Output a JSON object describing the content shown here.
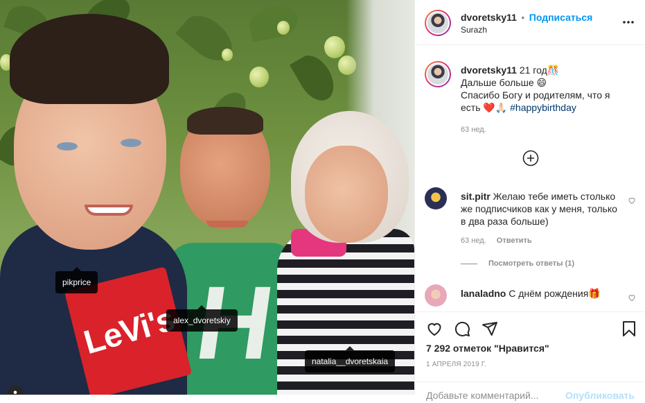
{
  "photo": {
    "tags": [
      "pikprice",
      "alex_dvoretskiy",
      "natalia__dvoretskaia"
    ],
    "print_text": "LeVi's",
    "shirt_letter": "H"
  },
  "post": {
    "username": "dvoretsky11",
    "dot": "•",
    "follow_label": "Подписаться",
    "location": "Surazh",
    "more_icon": "more-dots-icon"
  },
  "caption": {
    "username": "dvoretsky11",
    "line1": "21 год🎊",
    "line2": "Дальше больше 😄",
    "line3": "Спасибо Богу и родителям, что я",
    "line4_start": "есть ❤️🙏🏻 ",
    "hashtag": "#happybirthday",
    "time": "63 нед."
  },
  "load_more_icon": "plus-circle-icon",
  "comments": [
    {
      "username": "sit.pitr",
      "text": "Желаю тебе иметь столько же подписчиков как у меня, только в два раза больше)",
      "time": "63 нед.",
      "reply_label": "Ответить",
      "view_replies": "Посмотреть ответы (1)"
    },
    {
      "username": "lanaladno",
      "text": "С днём рождения🎁"
    }
  ],
  "actions": {
    "likes": "7 292 отметок \"Нравится\"",
    "date": "1 АПРЕЛЯ 2019 Г.",
    "add_comment": "Добавьте комментарий...",
    "publish": "Опубликовать"
  },
  "colors": {
    "accent": "#0095f6",
    "heart": "#d0021b",
    "text": "#262626",
    "muted": "#8e8e8e"
  }
}
